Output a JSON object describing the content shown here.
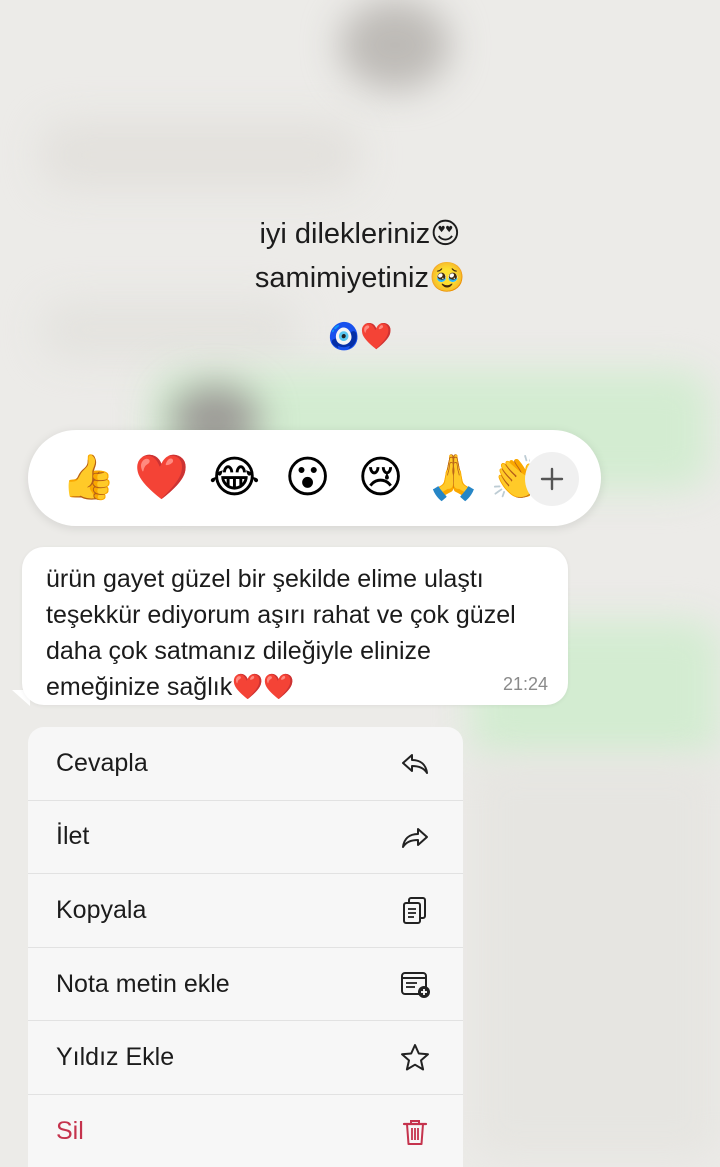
{
  "caption": {
    "line1": "iyi dilekleriniz😍",
    "line2": "samimiyetiniz🥹",
    "emojis": "🧿❤️"
  },
  "reactions": [
    {
      "emoji": "👍",
      "icon": "thumbs-up"
    },
    {
      "emoji": "❤️",
      "icon": "red-heart"
    },
    {
      "emoji": "😂",
      "icon": "tears-of-joy"
    },
    {
      "emoji": "😮",
      "icon": "open-mouth"
    },
    {
      "emoji": "😢",
      "icon": "crying-face"
    },
    {
      "emoji": "🙏",
      "icon": "folded-hands"
    },
    {
      "emoji": "👏",
      "icon": "clapping-hands"
    }
  ],
  "message": {
    "text": "ürün gayet güzel bir şekilde elime ulaştı\nteşekkür ediyorum aşırı rahat ve çok güzel\ndaha çok satmanız dileğiyle elinize\nemeğinize sağlık❤️❤️",
    "time": "21:24"
  },
  "menu": {
    "items": [
      {
        "label": "Cevapla",
        "icon": "reply-icon"
      },
      {
        "label": "İlet",
        "icon": "forward-icon"
      },
      {
        "label": "Kopyala",
        "icon": "copy-icon"
      },
      {
        "label": "Nota metin ekle",
        "icon": "add-note-icon"
      },
      {
        "label": "Yıldız Ekle",
        "icon": "star-icon"
      },
      {
        "label": "Sil",
        "icon": "trash-icon",
        "color": "#c5334d"
      }
    ]
  }
}
